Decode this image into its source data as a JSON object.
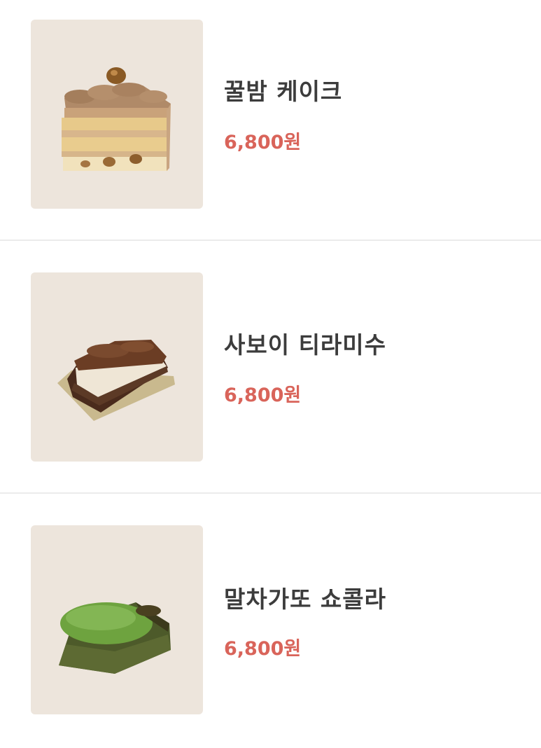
{
  "menu": {
    "items": [
      {
        "name": "꿀밤 케이크",
        "price": "6,800원",
        "image": "chestnut-cake-image"
      },
      {
        "name": "사보이 티라미수",
        "price": "6,800원",
        "image": "tiramisu-image"
      },
      {
        "name": "말차가또 쇼콜라",
        "price": "6,800원",
        "image": "matcha-chocolat-cake-image"
      }
    ]
  },
  "colors": {
    "thumb_bg": "#ede5dc",
    "price": "#d9645a",
    "name": "#3c3c3c",
    "divider": "#ebebeb"
  }
}
